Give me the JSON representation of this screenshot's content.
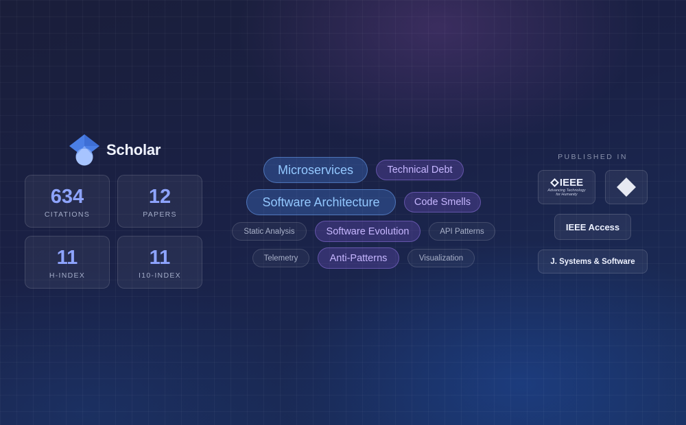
{
  "header": {
    "title": "Scholar",
    "logo_icon": "google-scholar-icon",
    "accent": "#8ea4ff"
  },
  "metrics": [
    {
      "value": "634",
      "label": "CITATIONS"
    },
    {
      "value": "12",
      "label": "PAPERS"
    },
    {
      "value": "11",
      "label": "H-INDEX"
    },
    {
      "value": "11",
      "label": "I10-INDEX"
    }
  ],
  "topics": {
    "large": [
      "Microservices",
      "Software Architecture"
    ],
    "medium": [
      "Technical Debt",
      "Code Smells",
      "Software Evolution",
      "Anti-Patterns"
    ],
    "small": [
      "Static Analysis",
      "API Patterns",
      "Telemetry",
      "Visualization"
    ]
  },
  "published_in": {
    "heading": "PUBLISHED IN",
    "ieee_logo": {
      "name": "IEEE",
      "tagline_1": "Advancing Technology",
      "tagline_2": "for Humanity"
    },
    "diamond_icon": "diamond-icon",
    "venues": [
      "IEEE Access",
      "J. Systems & Software"
    ]
  }
}
